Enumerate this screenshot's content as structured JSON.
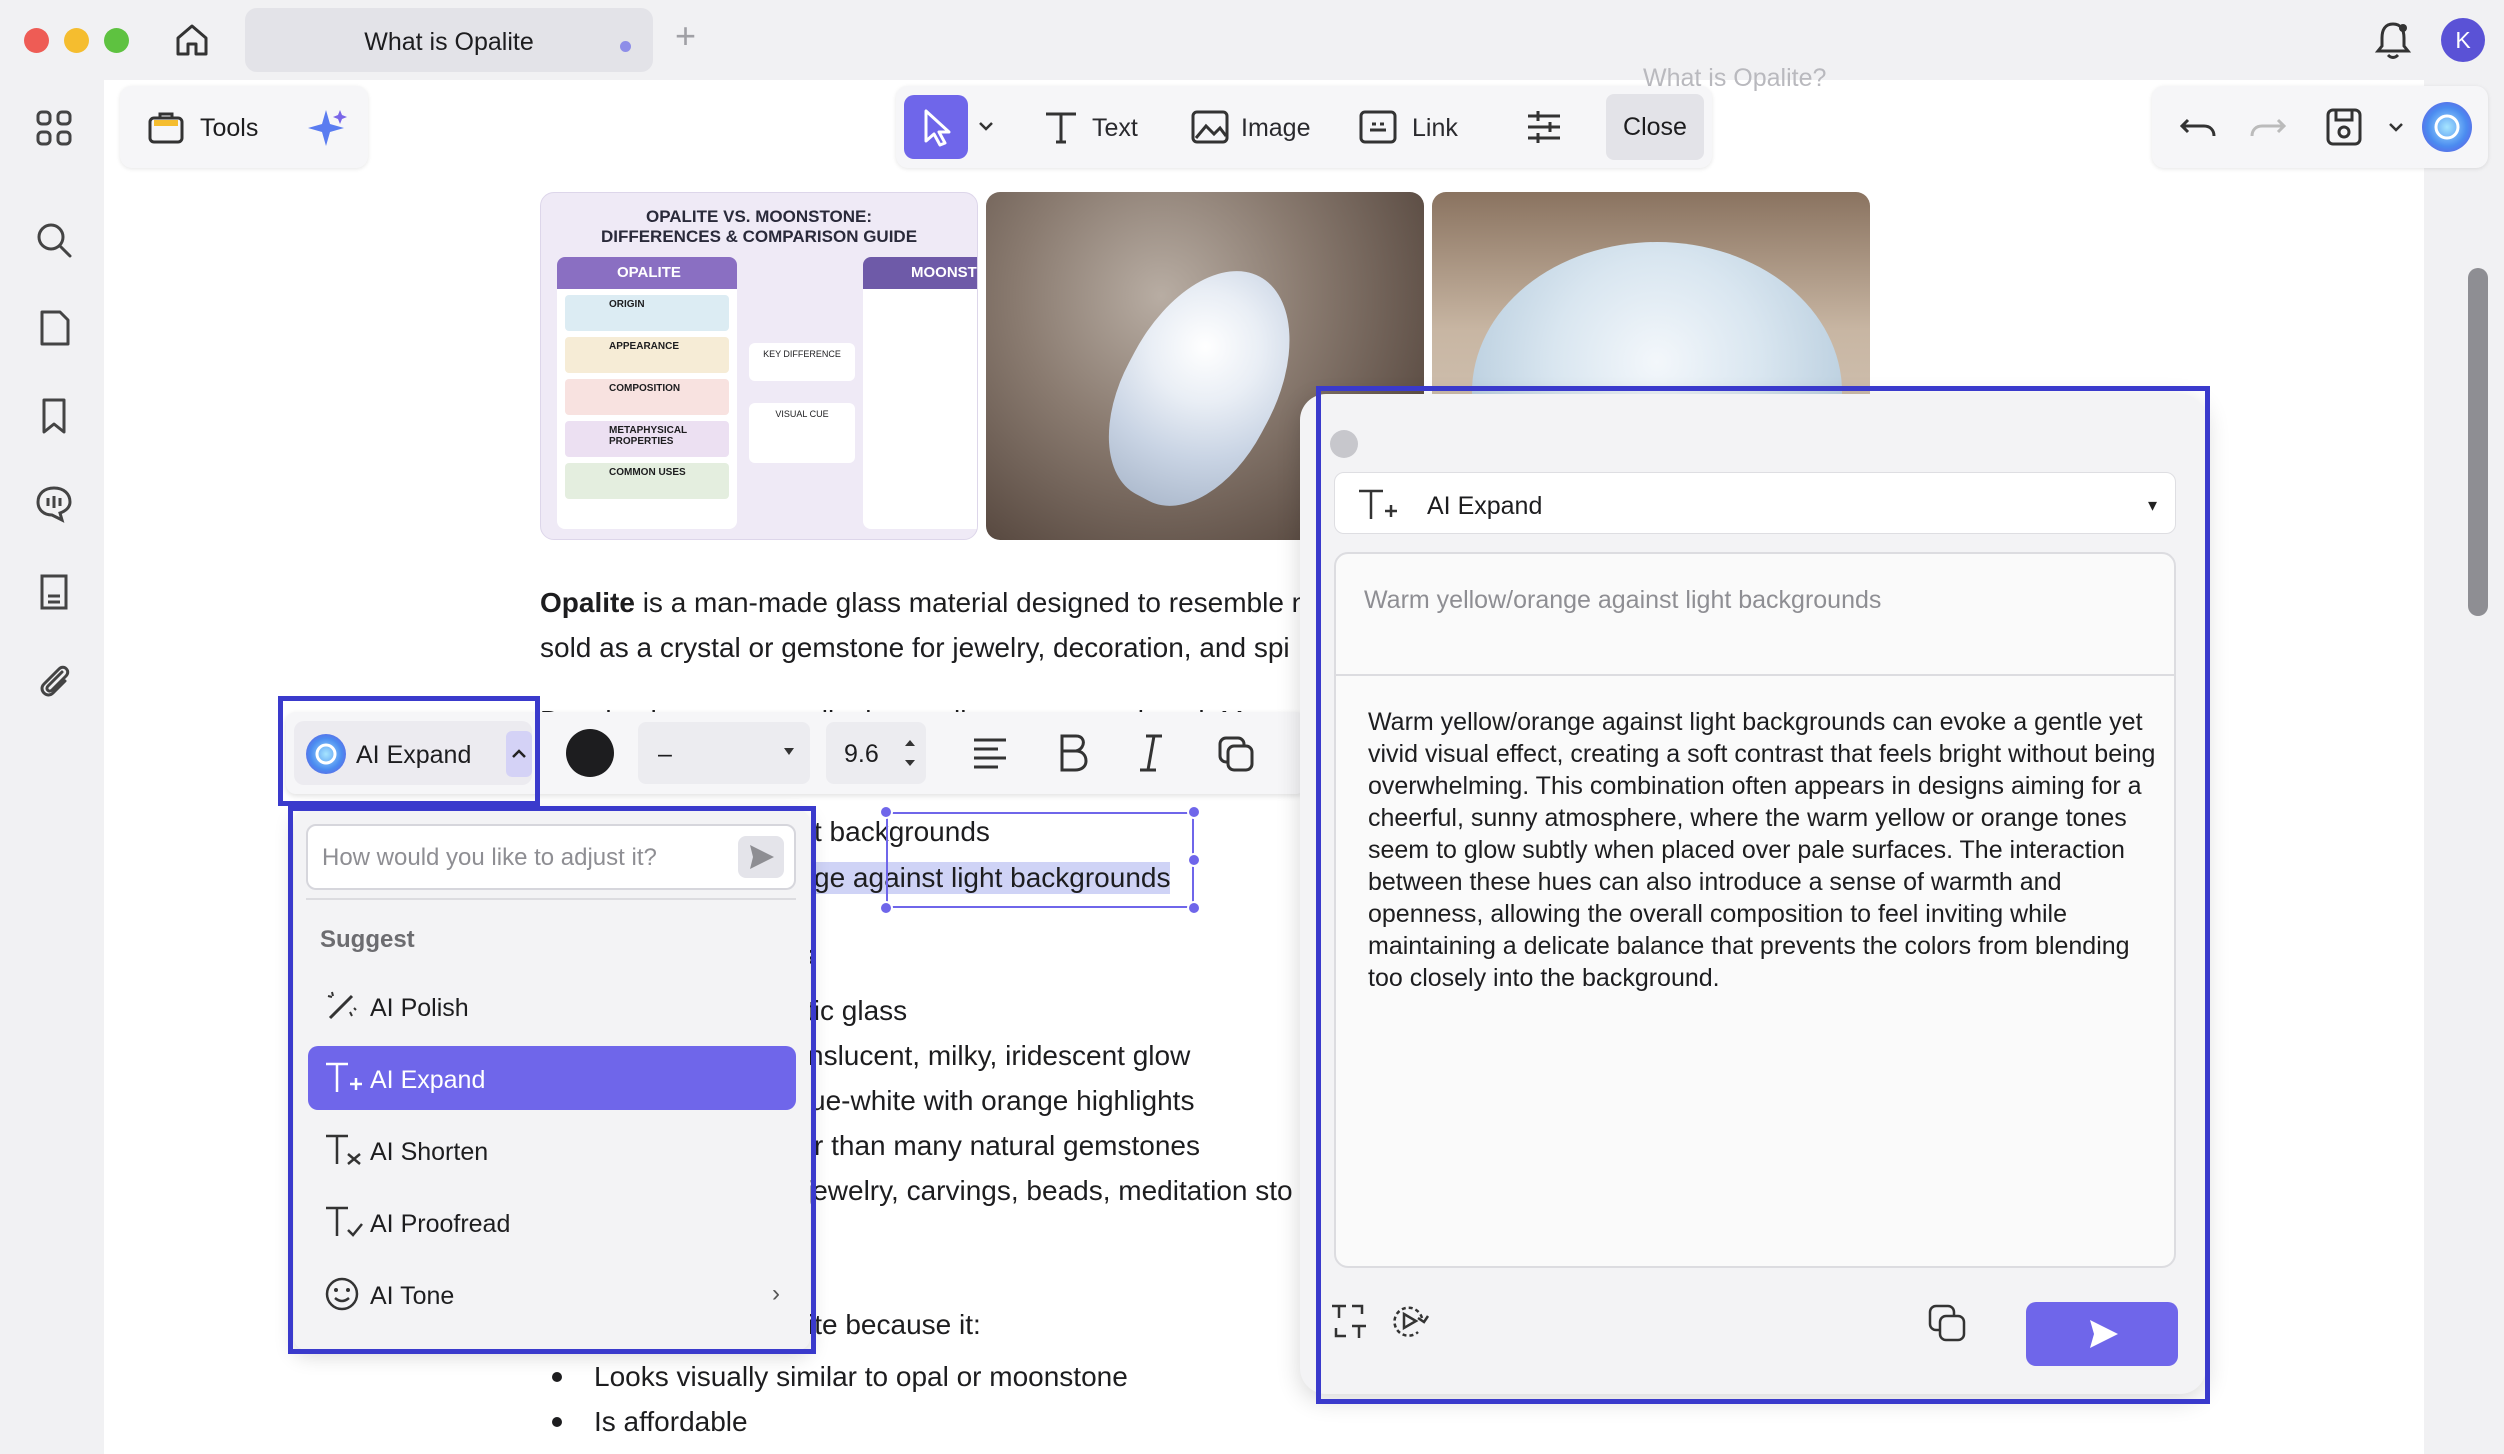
{
  "window": {
    "tab_title": "What is Opalite",
    "tab_add": "+",
    "avatar_initial": "K",
    "page_header_faint": "What is Opalite?"
  },
  "toolbar": {
    "tools_label": "Tools",
    "text_label": "Text",
    "image_label": "Image",
    "link_label": "Link",
    "close_label": "Close"
  },
  "infographic": {
    "title_line1": "OPALITE VS. MOONSTONE:",
    "title_line2": "DIFFERENCES & COMPARISON GUIDE",
    "col_left": "OPALITE",
    "col_right": "MOONST",
    "rows": [
      "ORIGIN",
      "APPEARANCE",
      "COMPOSITION",
      "METAPHYSICAL PROPERTIES",
      "COMMON USES"
    ],
    "key_difference": "KEY DIFFERENCE",
    "visual_cue": "VISUAL CUE"
  },
  "document": {
    "para1_bold": "Opalite",
    "para1_rest": " is a man-made glass material designed to resemble n",
    "para1_line2": "sold as a crystal or gemstone for jewelry, decoration, and spi",
    "overlap_line": "Despite the name, opalite is usually not a natural opal. Most",
    "sel_line1": "t backgrounds",
    "sel_line2": "ge against light backgrounds",
    "frag_s": "s",
    "frag_glass": "tic glass",
    "frag_glow": "nslucent, milky, iridescent glow",
    "frag_highlights": "ue-white with orange highlights",
    "frag_gemstones": "r than many natural gemstones",
    "frag_jewelry": "jewelry, carvings, beads, meditation sto",
    "frag_because": "ite because it:",
    "bullets": [
      "Looks visually similar to opal or moonstone",
      "Is affordable"
    ]
  },
  "format_bar": {
    "mode_label": "AI Expand",
    "font_value": "–",
    "size_value": "9.6"
  },
  "dropdown": {
    "placeholder": "How would you like to adjust it?",
    "suggest_heading": "Suggest",
    "items": [
      {
        "label": "AI Polish",
        "icon": "wand-icon"
      },
      {
        "label": "AI Expand",
        "icon": "text-expand-icon",
        "active": true
      },
      {
        "label": "AI Shorten",
        "icon": "text-shorten-icon"
      },
      {
        "label": "AI Proofread",
        "icon": "text-proofread-icon"
      },
      {
        "label": "AI Tone",
        "icon": "smiley-icon"
      }
    ],
    "tone_chevron": "›"
  },
  "ai_panel": {
    "mode_label": "AI Expand",
    "mode_caret": "▾",
    "query_text": "Warm yellow/orange against light backgrounds",
    "result_text": "Warm yellow/orange against light backgrounds can evoke a gentle yet vivid visual effect, creating a soft contrast that feels bright without being overwhelming. This combination often appears in designs aiming for a cheerful, sunny atmosphere, where the warm yellow or orange tones seem to glow subtly when placed over pale surfaces. The interaction between these hues can also introduce a sense of warmth and openness, allowing the overall composition to feel inviting while maintaining a delicate balance that prevents the colors from blending too closely into the background."
  },
  "colors": {
    "accent": "#6f66ea",
    "highlight_border": "#3a3acc",
    "traffic_red": "#ee5c55",
    "traffic_yellow": "#f5bd2f",
    "traffic_green": "#5ec240"
  }
}
